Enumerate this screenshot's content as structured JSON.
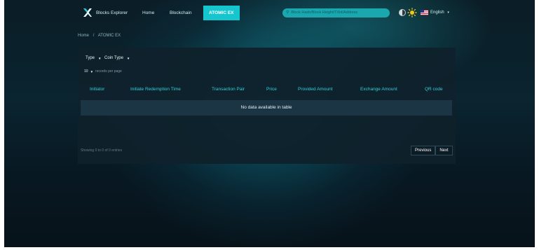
{
  "nav": {
    "brand": "Blocks Explorer",
    "links": [
      "Home",
      "Blockchain",
      "ATOMIC EX"
    ],
    "search_placeholder": "Block Hash/Block Height/TXid/Address",
    "language": "English"
  },
  "breadcrumb": {
    "home": "Home",
    "separator": "/",
    "current": "ATOMIC EX"
  },
  "filters": {
    "type": "Type",
    "coin_type": "Coin Type"
  },
  "per_page": {
    "value": "10",
    "label": "records per page"
  },
  "table": {
    "headers": [
      "Initiator",
      "Initiate Redemption Time",
      "Transaction Pair",
      "Price",
      "Provided Amount",
      "Exchange Amount",
      "QR code"
    ],
    "empty_message": "No data available in table"
  },
  "footer": {
    "showing": "Showing 0 to 0 of 0 entries",
    "previous": "Previous",
    "next": "Next"
  },
  "colors": {
    "accent": "#16c6cf",
    "header_text": "#2fd1da",
    "panel": "#0f212c"
  }
}
